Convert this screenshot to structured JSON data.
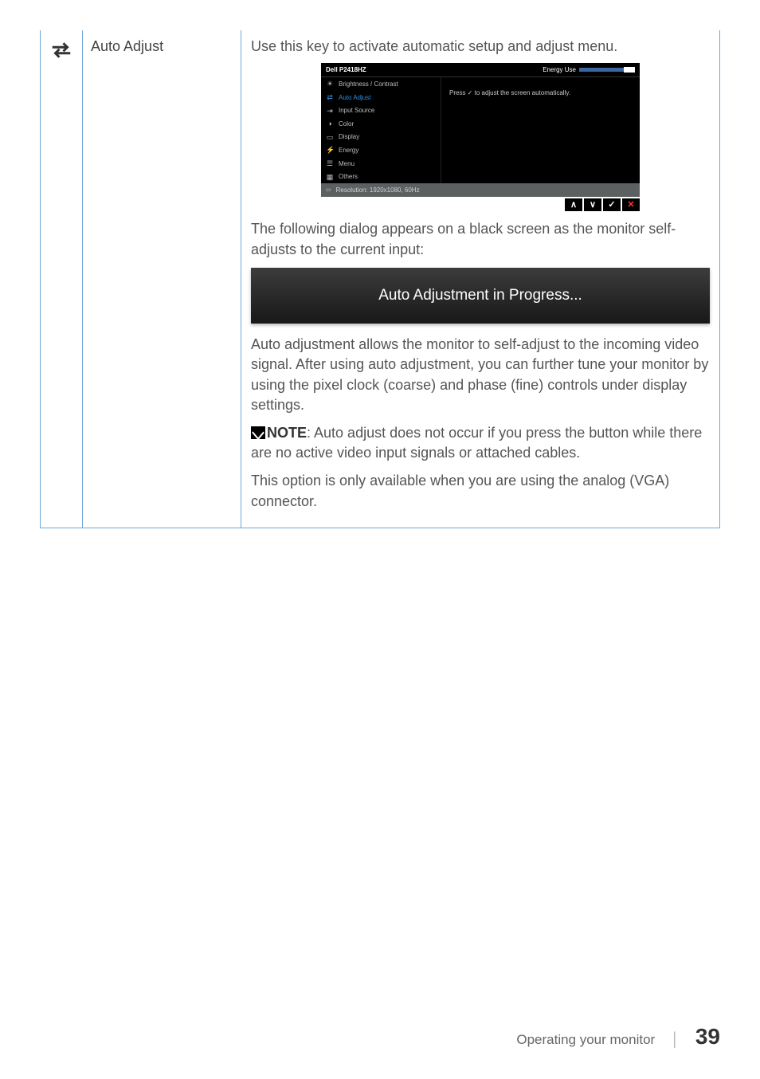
{
  "row": {
    "title": "Auto Adjust",
    "intro": "Use this key to activate automatic setup and adjust menu.",
    "osd": {
      "model": "Dell P2418HZ",
      "energy_label": "Energy Use",
      "menu": [
        {
          "icon": "☀",
          "label": "Brightness / Contrast",
          "selected": false
        },
        {
          "icon": "⇄",
          "label": "Auto Adjust",
          "selected": true
        },
        {
          "icon": "⇥",
          "label": "Input Source",
          "selected": false
        },
        {
          "icon": "◑",
          "label": "Color",
          "selected": false
        },
        {
          "icon": "▭",
          "label": "Display",
          "selected": false
        },
        {
          "icon": "⚡",
          "label": "Energy",
          "selected": false
        },
        {
          "icon": "☰",
          "label": "Menu",
          "selected": false
        },
        {
          "icon": "▦",
          "label": "Others",
          "selected": false
        }
      ],
      "pane_text": "Press ✓ to adjust the screen automatically.",
      "resolution": "Resolution: 1920x1080, 60Hz",
      "buttons": [
        "∧",
        "∨",
        "✓",
        "✕"
      ]
    },
    "para2a": "The following dialog appears on a black screen as the monitor self-adjusts to the current input:",
    "progress": "Auto Adjustment in Progress...",
    "para3": "Auto adjustment allows the monitor to self-adjust to the incoming video signal. After using auto adjustment, you can further tune your monitor by using the pixel clock (coarse) and phase (fine) controls under display settings.",
    "note_label": "NOTE",
    "note_text": ": Auto adjust does not occur if you press the button while there are no active video input signals or attached cables.",
    "para4": "This option is only available when you are using the analog (VGA) connector."
  },
  "footer": {
    "section": "Operating your monitor",
    "page": "39"
  }
}
